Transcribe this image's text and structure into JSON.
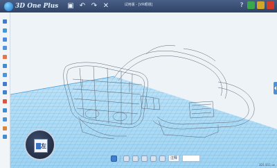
{
  "app": {
    "name": "3D One Plus",
    "document_title": "试用版 - [VR眼镜]"
  },
  "title_buttons": [
    {
      "name": "save-icon",
      "glyph": "▣"
    },
    {
      "name": "undo-icon",
      "glyph": "↶"
    },
    {
      "name": "redo-icon",
      "glyph": "↷"
    },
    {
      "name": "close-doc-icon",
      "glyph": "✕"
    }
  ],
  "window": {
    "help": "?"
  },
  "left_tools": [
    {
      "name": "sketch-tool-icon",
      "color": "#2f6fbf"
    },
    {
      "name": "basic-solid-tool-icon",
      "color": "#2f8fd0"
    },
    {
      "name": "curve-tool-icon",
      "color": "#3a7ed8"
    },
    {
      "name": "feature-tool-icon",
      "color": "#3f8bdc"
    },
    {
      "name": "edit-tool-icon",
      "color": "#e0673a"
    },
    {
      "name": "combine-tool-icon",
      "color": "#2f7fc8"
    },
    {
      "name": "move-tool-icon",
      "color": "#3a8ad8"
    },
    {
      "name": "array-tool-icon",
      "color": "#2d70c4"
    },
    {
      "name": "bend-tool-icon",
      "color": "#2978c8"
    },
    {
      "name": "color-tool-icon",
      "color": "#d9442c"
    },
    {
      "name": "material-tool-icon",
      "color": "#2f7fc8"
    },
    {
      "name": "measure-tool-icon",
      "color": "#3a86d4"
    },
    {
      "name": "assembly-tool-icon",
      "color": "#d47a28"
    },
    {
      "name": "browser-tool-icon",
      "color": "#2f7fc8"
    }
  ],
  "viewcube": {
    "face_label": "左"
  },
  "bottom_tools": [
    {
      "name": "view-eye-icon"
    },
    {
      "name": "page-icon"
    },
    {
      "name": "box-icon"
    },
    {
      "name": "zoom-icon"
    },
    {
      "name": "fit-view-icon"
    },
    {
      "name": "render-icon"
    }
  ],
  "bottom_field": {
    "label": "注释"
  },
  "status": {
    "text": "3D1 B11 us"
  },
  "colors": {
    "titlebar": "#3b5079",
    "grid": "#5fb3e6",
    "model_line": "#5c6370"
  }
}
